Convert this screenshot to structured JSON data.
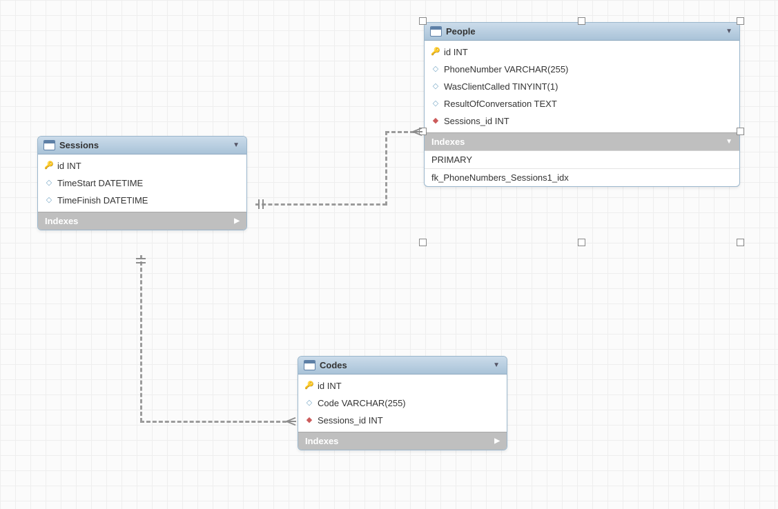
{
  "entities": {
    "sessions": {
      "title": "Sessions",
      "columns": [
        {
          "icon": "key",
          "text": "id INT"
        },
        {
          "icon": "attr",
          "text": "TimeStart DATETIME"
        },
        {
          "icon": "attr",
          "text": "TimeFinish DATETIME"
        }
      ],
      "indexes_label": "Indexes",
      "indexes_expanded": false,
      "index_items": []
    },
    "people": {
      "title": "People",
      "columns": [
        {
          "icon": "key",
          "text": "id INT"
        },
        {
          "icon": "attr",
          "text": "PhoneNumber VARCHAR(255)"
        },
        {
          "icon": "attr",
          "text": "WasClientCalled TINYINT(1)"
        },
        {
          "icon": "attr",
          "text": "ResultOfConversation TEXT"
        },
        {
          "icon": "fk",
          "text": "Sessions_id INT"
        }
      ],
      "indexes_label": "Indexes",
      "indexes_expanded": true,
      "index_items": [
        "PRIMARY",
        "fk_PhoneNumbers_Sessions1_idx"
      ]
    },
    "codes": {
      "title": "Codes",
      "columns": [
        {
          "icon": "key",
          "text": "id INT"
        },
        {
          "icon": "attr",
          "text": "Code VARCHAR(255)"
        },
        {
          "icon": "fk",
          "text": "Sessions_id INT"
        }
      ],
      "indexes_label": "Indexes",
      "indexes_expanded": false,
      "index_items": []
    }
  },
  "relationships": [
    {
      "from": "Sessions",
      "to": "People",
      "type": "one-to-many"
    },
    {
      "from": "Sessions",
      "to": "Codes",
      "type": "one-to-many"
    }
  ]
}
